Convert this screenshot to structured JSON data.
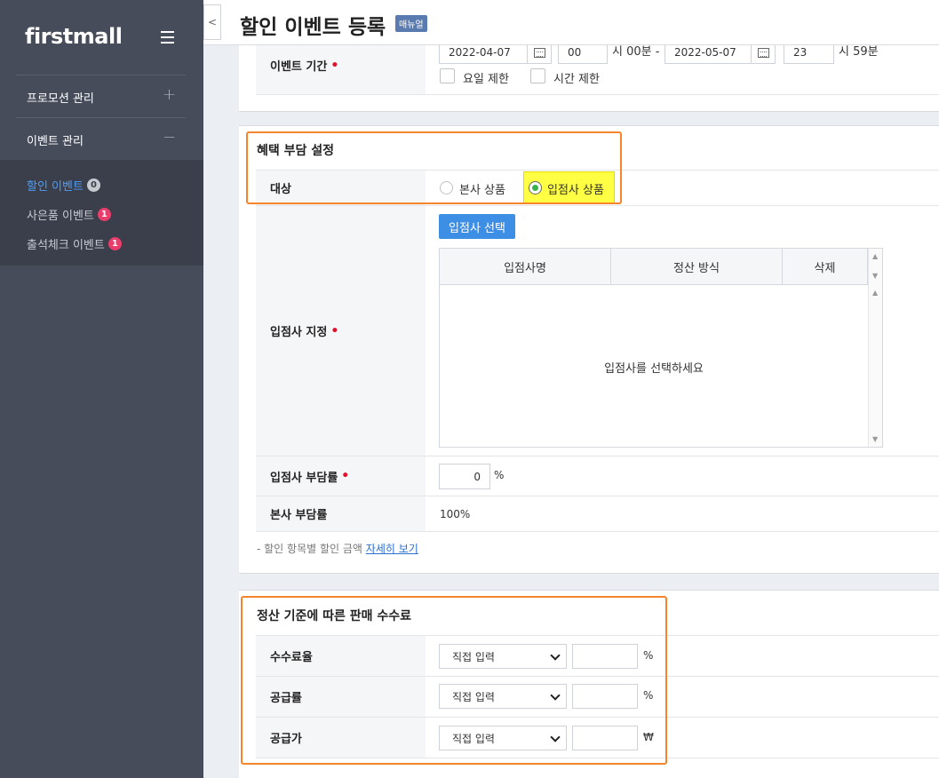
{
  "sidebar": {
    "brand": "firstmall",
    "groups": [
      {
        "label": "프로모션 관리",
        "toggle": "+"
      },
      {
        "label": "이벤트 관리",
        "toggle": "−"
      }
    ],
    "subitems": [
      {
        "label": "할인 이벤트",
        "badge": "0"
      },
      {
        "label": "사은품 이벤트",
        "badge": "1"
      },
      {
        "label": "출석체크 이벤트",
        "badge": "1"
      }
    ]
  },
  "header": {
    "back": "<",
    "title": "할인 이벤트 등록",
    "manual_tag": "매뉴얼"
  },
  "event_period": {
    "label": "이벤트 기간",
    "start_date": "2022-04-07",
    "start_hour": "00",
    "start_suffix": "시 00분 -",
    "end_date": "2022-05-07",
    "end_hour": "23",
    "end_suffix": "시 59분",
    "day_limit": "요일 제한",
    "time_limit": "시간 제한"
  },
  "benefit": {
    "title": "혜택 부담 설정",
    "target_label": "대상",
    "option_head": "본사 상품",
    "option_vendor": "입점사 상품",
    "vendor_assign_label": "입점사 지정",
    "select_vendor_button": "입점사 선택",
    "grid_headers": [
      "입점사명",
      "정산 방식",
      "삭제"
    ],
    "grid_empty": "입점사를 선택하세요",
    "vendor_ratio_label": "입점사 부담률",
    "vendor_ratio_value": "0",
    "vendor_ratio_unit": "%",
    "head_ratio_label": "본사 부담률",
    "head_ratio_value": "100%",
    "note_prefix": "- 할인 항목별 할인 금액",
    "note_link": "자세히 보기"
  },
  "commission": {
    "title": "정산 기준에 따른 판매 수수료",
    "rows": [
      {
        "label": "수수료율",
        "select": "직접 입력",
        "value": "",
        "unit": "%"
      },
      {
        "label": "공급률",
        "select": "직접 입력",
        "value": "",
        "unit": "%"
      },
      {
        "label": "공급가",
        "select": "직접 입력",
        "value": "",
        "unit": "₩"
      }
    ]
  },
  "colors": {
    "sidebar": "#464c5a",
    "accent_blue": "#3d8fe5",
    "annotation_orange": "#f4852c",
    "highlight_yellow": "#ffff44"
  }
}
